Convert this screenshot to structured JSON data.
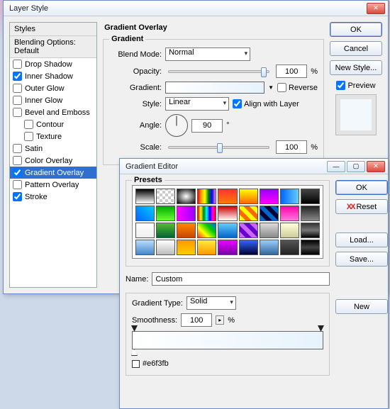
{
  "layerStyle": {
    "title": "Layer Style",
    "stylesHeader": "Styles",
    "blendingDefault": "Blending Options: Default",
    "items": [
      {
        "label": "Drop Shadow",
        "checked": false
      },
      {
        "label": "Inner Shadow",
        "checked": true
      },
      {
        "label": "Outer Glow",
        "checked": false
      },
      {
        "label": "Inner Glow",
        "checked": false
      },
      {
        "label": "Bevel and Emboss",
        "checked": false
      },
      {
        "label": "Contour",
        "checked": false,
        "indent": true
      },
      {
        "label": "Texture",
        "checked": false,
        "indent": true
      },
      {
        "label": "Satin",
        "checked": false
      },
      {
        "label": "Color Overlay",
        "checked": false
      },
      {
        "label": "Gradient Overlay",
        "checked": true,
        "selected": true
      },
      {
        "label": "Pattern Overlay",
        "checked": false
      },
      {
        "label": "Stroke",
        "checked": true
      }
    ],
    "panelTitle": "Gradient Overlay",
    "groupTitle": "Gradient",
    "labels": {
      "blendMode": "Blend Mode:",
      "opacity": "Opacity:",
      "gradient": "Gradient:",
      "style": "Style:",
      "angle": "Angle:",
      "scale": "Scale:",
      "reverse": "Reverse",
      "align": "Align with Layer"
    },
    "values": {
      "blendMode": "Normal",
      "opacity": "100",
      "style": "Linear",
      "angle": "90",
      "scale": "100",
      "reverseChecked": false,
      "alignChecked": true,
      "pct": "%",
      "deg": "°"
    },
    "buttons": {
      "ok": "OK",
      "cancel": "Cancel",
      "newStyle": "New Style...",
      "preview": "Preview"
    }
  },
  "gradientEditor": {
    "title": "Gradient Editor",
    "presetsLabel": "Presets",
    "swatches": [
      "linear-gradient(#000,#fff)",
      "repeating-conic-gradient(#ccc 0 25%,#fff 0 50%) 0/8px 8px",
      "radial-gradient(#fff,#000)",
      "linear-gradient(90deg,red,orange,yellow,green,blue,violet)",
      "linear-gradient(#f33,#ff7b00)",
      "linear-gradient(#ff0,#f60)",
      "linear-gradient(#90f,#f0f)",
      "linear-gradient(90deg,#06f,#6cf)",
      "linear-gradient(#444,#000)",
      "linear-gradient(45deg,#06f,#0cf)",
      "linear-gradient(#0a0,#6f3)",
      "linear-gradient(90deg,#f0f,#90f)",
      "linear-gradient(90deg,red,yellow,green,cyan,blue,magenta,red)",
      "linear-gradient(#c00,#fff)",
      "repeating-linear-gradient(45deg,#ff0 0 6px,#f60 0 12px)",
      "repeating-linear-gradient(45deg,#06c 0 6px,#003 0 12px)",
      "linear-gradient(#f0a,#f7d)",
      "linear-gradient(#222,#888)",
      "linear-gradient(#fff,#eee)",
      "linear-gradient(#5b3,#063)",
      "linear-gradient(#f80,#c40)",
      "linear-gradient(45deg,#f33,#ff0,#0c0,#06f)",
      "linear-gradient(#6cf,#06c)",
      "repeating-linear-gradient(45deg,#c6f 0 6px,#60c 0 12px)",
      "linear-gradient(#ddd,#888)",
      "linear-gradient(#ffd,#cc9)",
      "linear-gradient(#333,#777,#000)",
      "linear-gradient(#bdf,#48c)",
      "linear-gradient(#fff,#bbb)",
      "linear-gradient(#f90,#fc0)",
      "linear-gradient(#ffeb3b,#ff9800)",
      "linear-gradient(#e0f,#70a)",
      "linear-gradient(#36f,#003)",
      "linear-gradient(#9cf,#369)",
      "linear-gradient(#555,#222)",
      "linear-gradient(#000,#444,#000)"
    ],
    "nameLabel": "Name:",
    "nameValue": "Custom",
    "typeLabel": "Gradient Type:",
    "typeValue": "Solid",
    "smoothLabel": "Smoothness:",
    "smoothValue": "100",
    "pct": "%",
    "hex": "#e6f3fb",
    "buttons": {
      "ok": "OK",
      "reset": "Reset",
      "load": "Load...",
      "save": "Save...",
      "new": "New"
    }
  }
}
